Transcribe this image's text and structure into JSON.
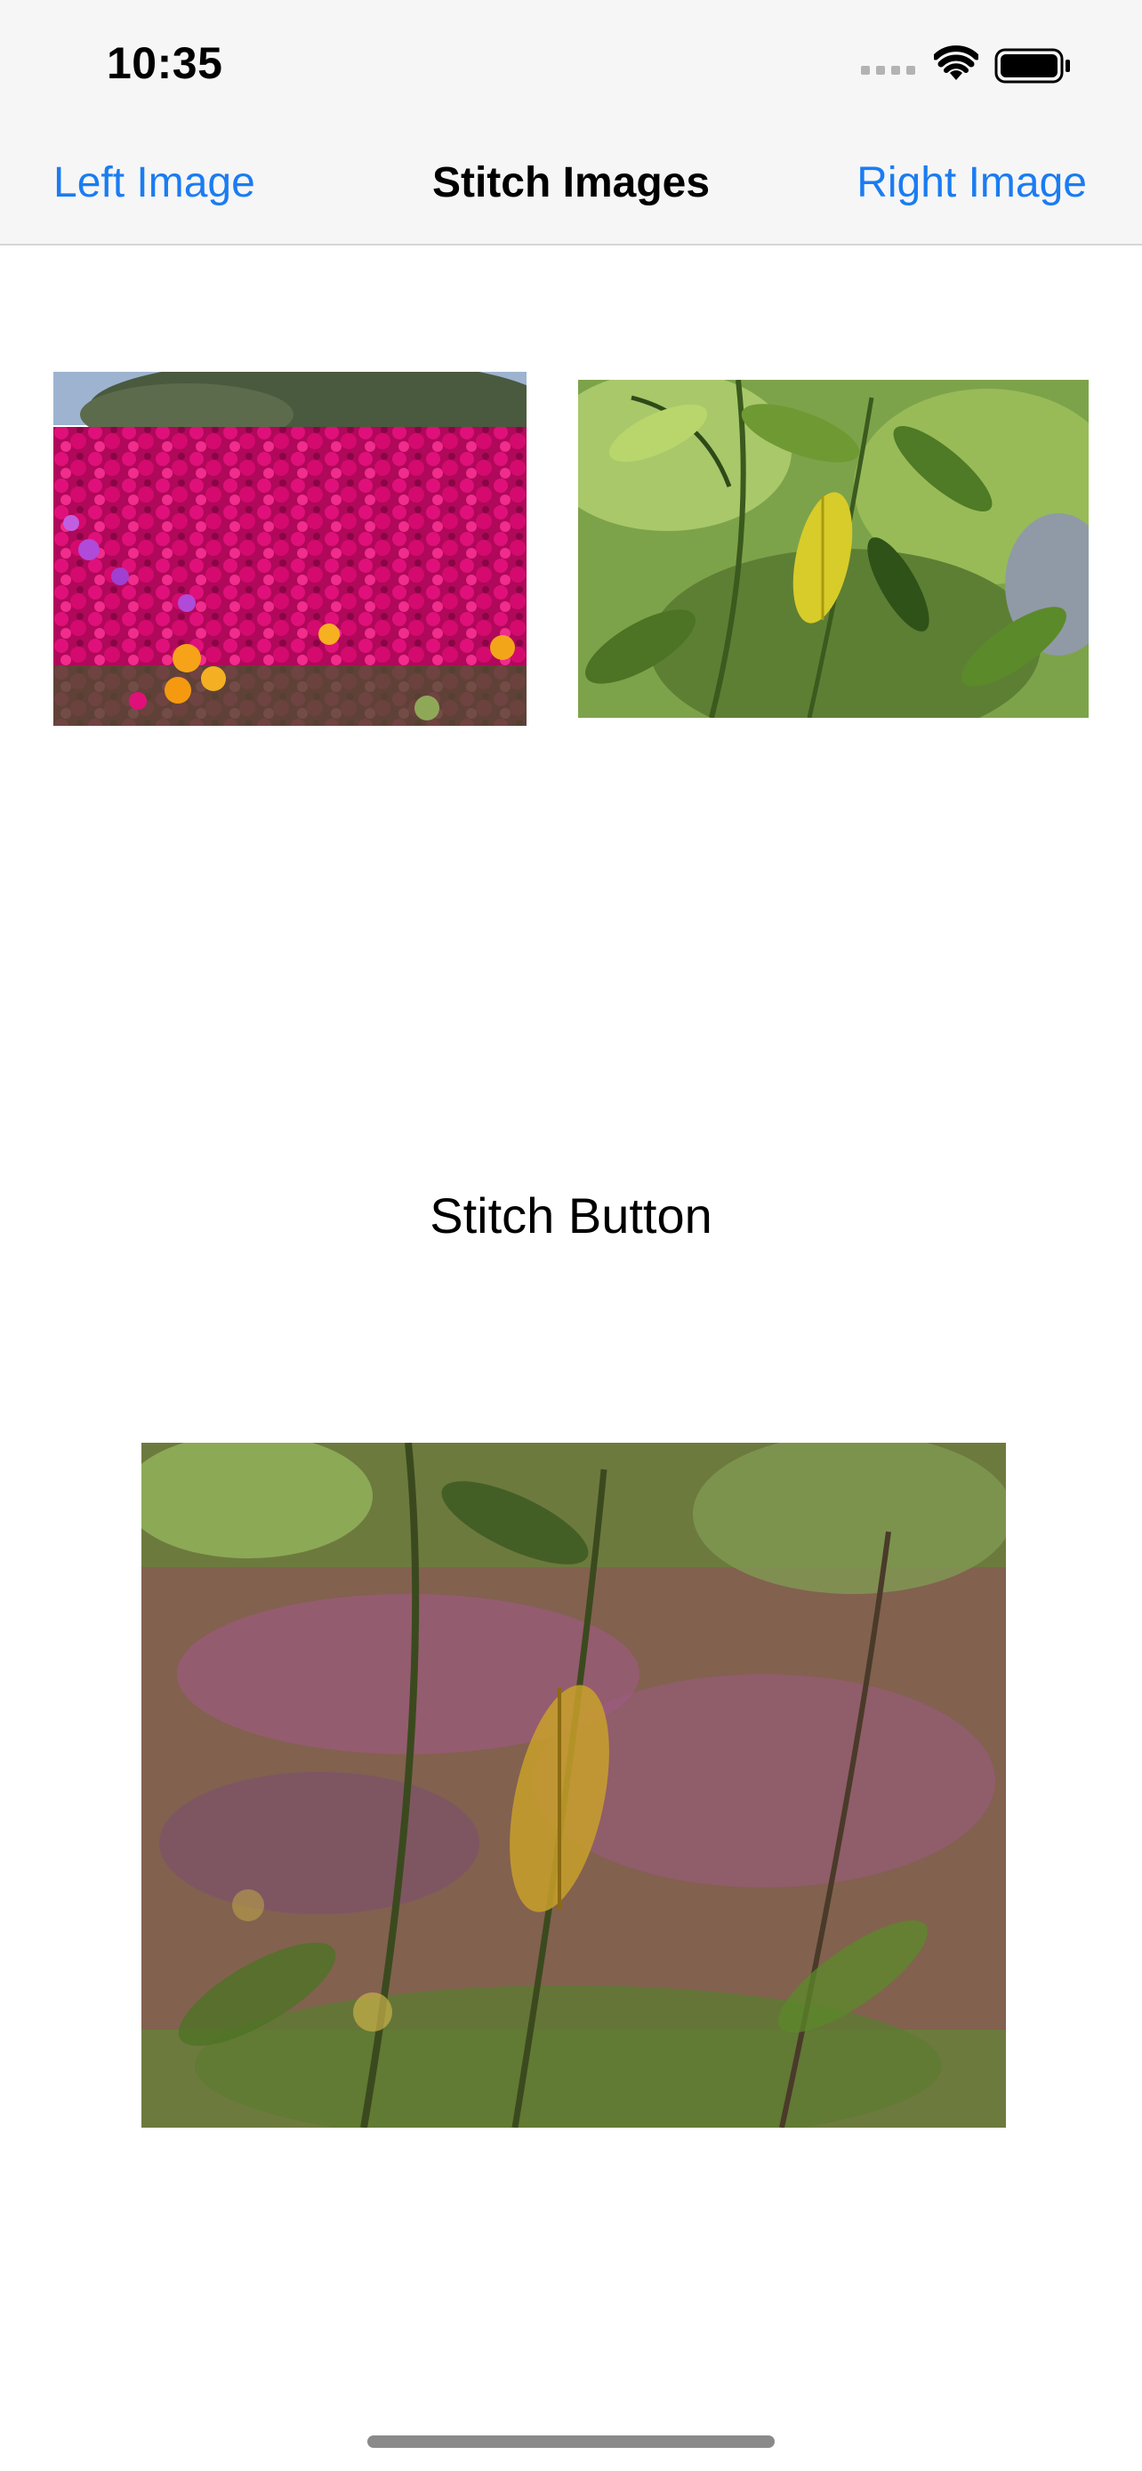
{
  "status_bar": {
    "time": "10:35",
    "icons": [
      "cellular-signal-icon",
      "wifi-icon",
      "battery-icon"
    ]
  },
  "nav_bar": {
    "left_button": "Left Image",
    "title": "Stitch Images",
    "right_button": "Right Image",
    "accent_color": "#1b7cf2"
  },
  "images": {
    "left": {
      "subject": "magenta and orange flowers in front of shrubs"
    },
    "right": {
      "subject": "green leaves with a yellow leaf"
    },
    "result": {
      "subject": "blended overlay of flowers and leaves"
    }
  },
  "stitch_button": {
    "label": "Stitch Button"
  }
}
